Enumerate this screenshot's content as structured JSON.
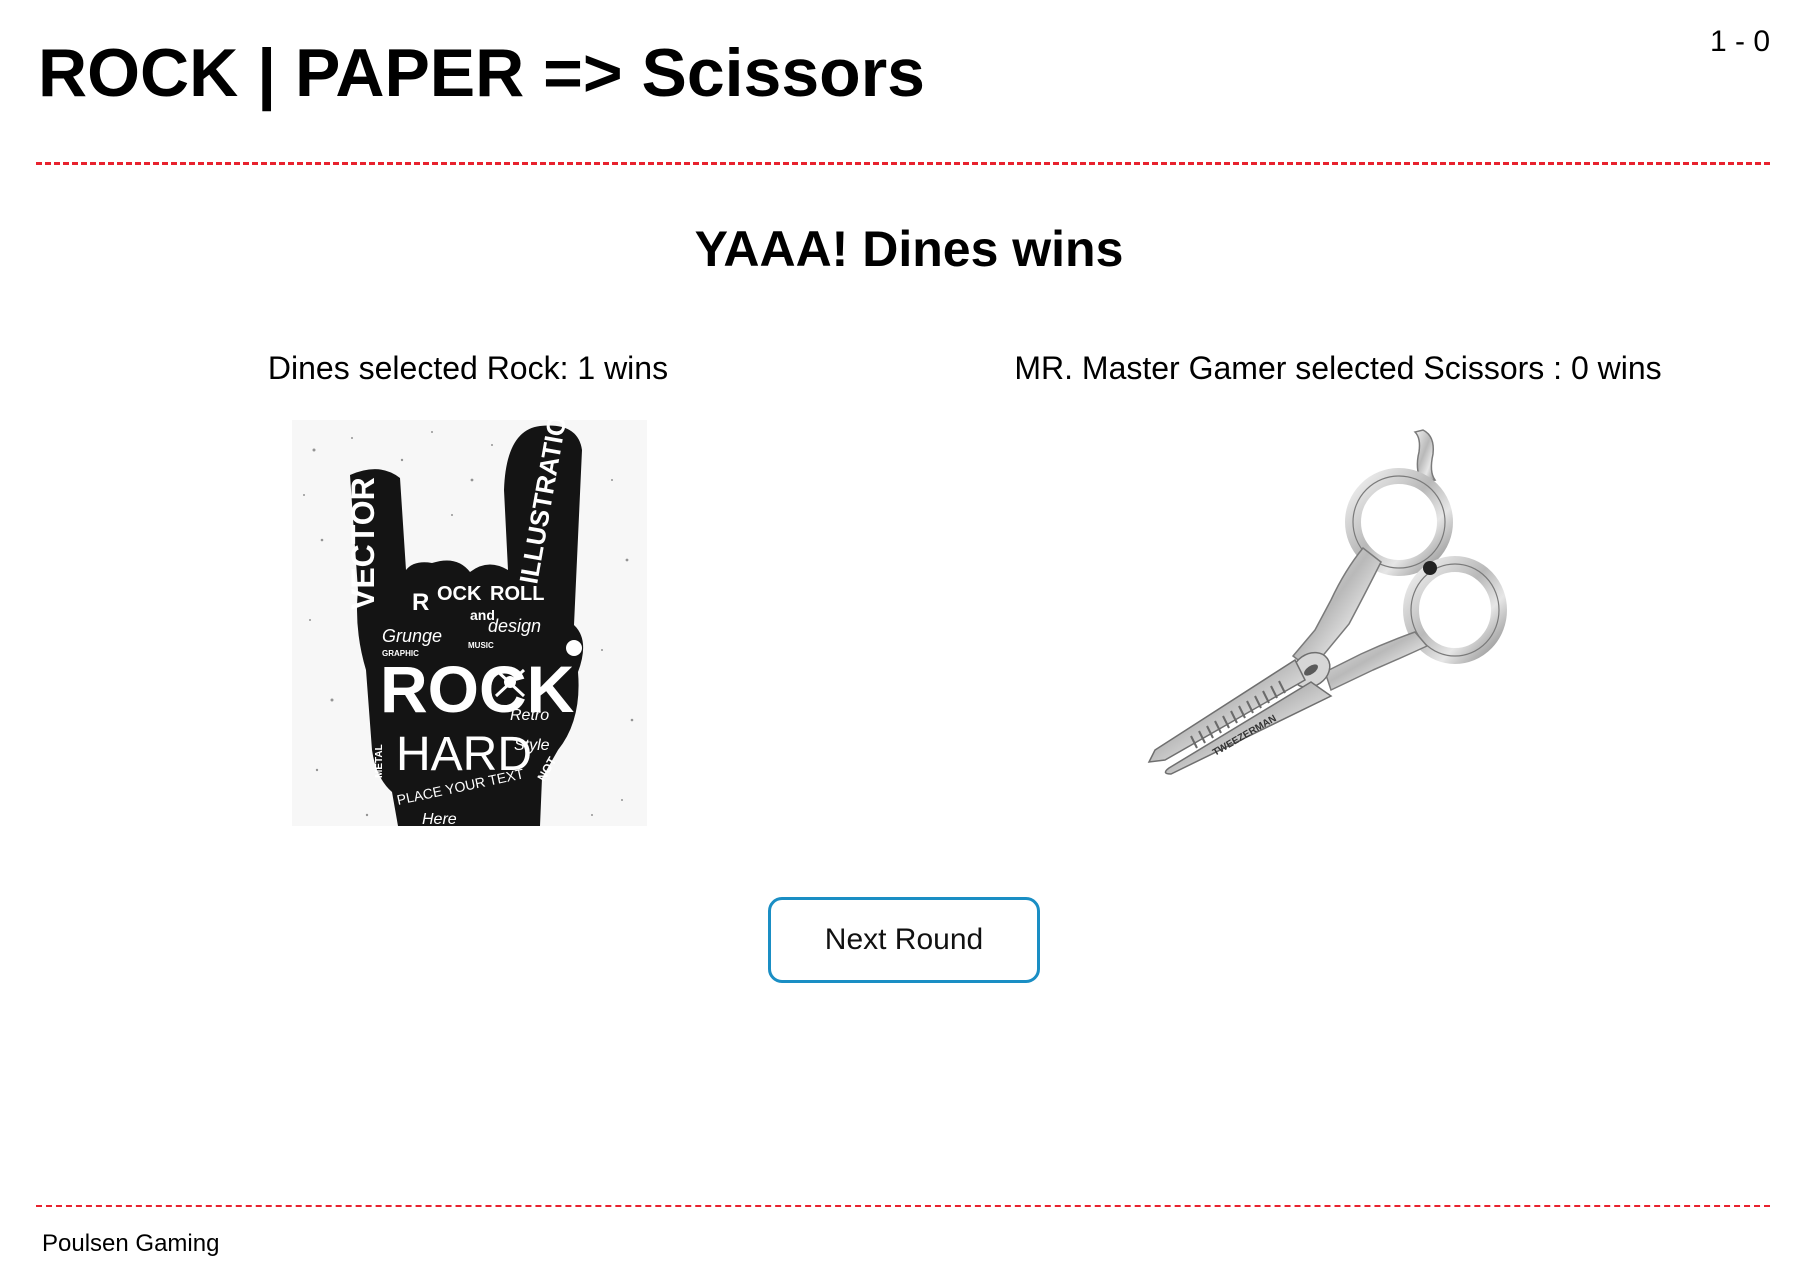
{
  "header": {
    "title": "ROCK | PAPER => Scissors",
    "score": "1 - 0"
  },
  "result": {
    "message": "YAAA! Dines wins"
  },
  "players": [
    {
      "label": "Dines selected Rock: 1 wins",
      "choice": "Rock",
      "image_icon": "rock-hand-icon",
      "image_text": [
        "VECTOR",
        "ILLUSTRATION",
        "ROCK",
        "and",
        "ROLL",
        "Grunge",
        "design",
        "ROCK",
        "HARD",
        "Retro",
        "Style",
        "PLACE YOUR TEXT",
        "NOT",
        "Here",
        "METAL",
        "GRAPHIC",
        "MUSIC"
      ]
    },
    {
      "label": "MR. Master Gamer selected Scissors : 0 wins",
      "choice": "Scissors",
      "image_icon": "thinning-scissors-icon",
      "image_text": [
        "TWEEZERMAN"
      ]
    }
  ],
  "actions": {
    "next_round_label": "Next Round"
  },
  "footer": {
    "text": "Poulsen Gaming"
  },
  "colors": {
    "divider": "#e8222e",
    "button_border": "#1a8ec4"
  }
}
